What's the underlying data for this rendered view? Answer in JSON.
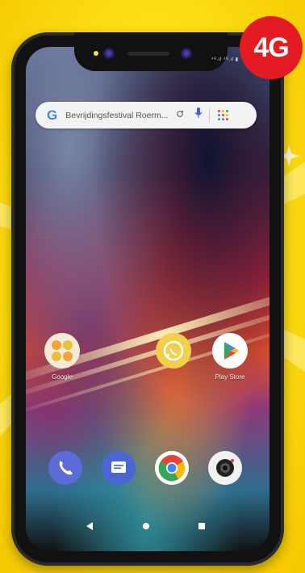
{
  "badge": {
    "label": "4G",
    "color": "#e41b23"
  },
  "search": {
    "logo": "G",
    "query": "Bevrijdingsfestival Roerm...",
    "icons": [
      "lens-icon",
      "mic-icon",
      "apps-grid-icon"
    ]
  },
  "home_apps": [
    {
      "label": "Google",
      "icon": "google-folder-icon"
    },
    {
      "label": "",
      "icon": "whatsapp-icon"
    },
    {
      "label": "Play Store",
      "icon": "play-store-icon"
    }
  ],
  "dock": [
    {
      "icon": "phone-icon"
    },
    {
      "icon": "messages-icon"
    },
    {
      "icon": "chrome-icon"
    },
    {
      "icon": "camera-icon"
    }
  ],
  "nav": [
    "back-icon",
    "home-icon",
    "recents-icon"
  ],
  "colors": {
    "background": "#fde21a",
    "badge": "#e41b23",
    "google_blue": "#4285f4"
  }
}
